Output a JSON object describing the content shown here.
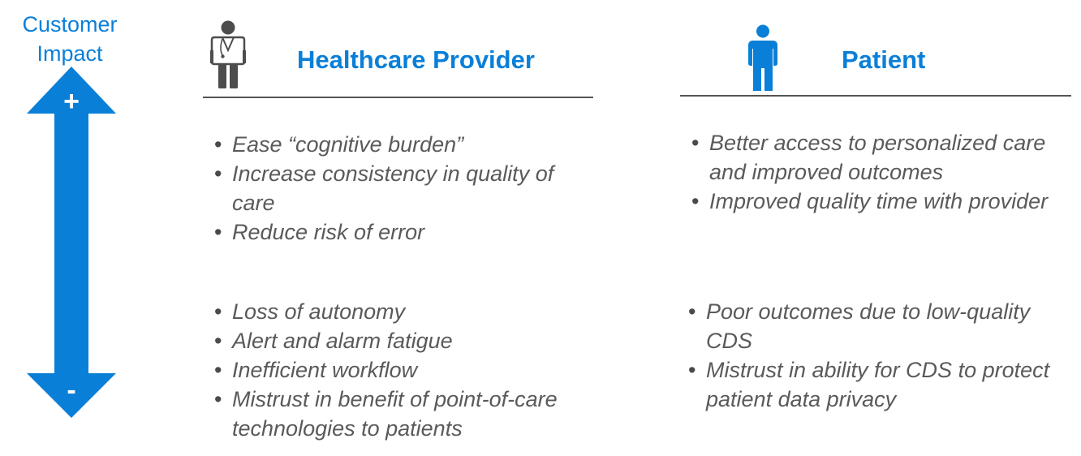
{
  "axis": {
    "title_line1": "Customer",
    "title_line2": "Impact",
    "top_sign": "+",
    "bottom_sign": "-"
  },
  "colors": {
    "accent": "#0a7fd8",
    "text": "#5a5a5a",
    "rule": "#555555",
    "icon_gray": "#4d4d4d"
  },
  "provider": {
    "icon": "doctor-icon",
    "title": "Healthcare Provider",
    "positive": [
      "Ease “cognitive burden”",
      "Increase consistency in quality of care",
      "Reduce risk of error"
    ],
    "negative": [
      "Loss of autonomy",
      "Alert and alarm fatigue",
      "Inefficient workflow",
      "Mistrust in benefit of point-of-care technologies to patients"
    ]
  },
  "patient": {
    "icon": "person-icon",
    "title": "Patient",
    "positive": [
      "Better access to personalized care and improved outcomes",
      "Improved quality time with provider"
    ],
    "negative": [
      "Poor outcomes due to low-quality CDS",
      "Mistrust in ability for CDS to protect patient data privacy"
    ]
  }
}
